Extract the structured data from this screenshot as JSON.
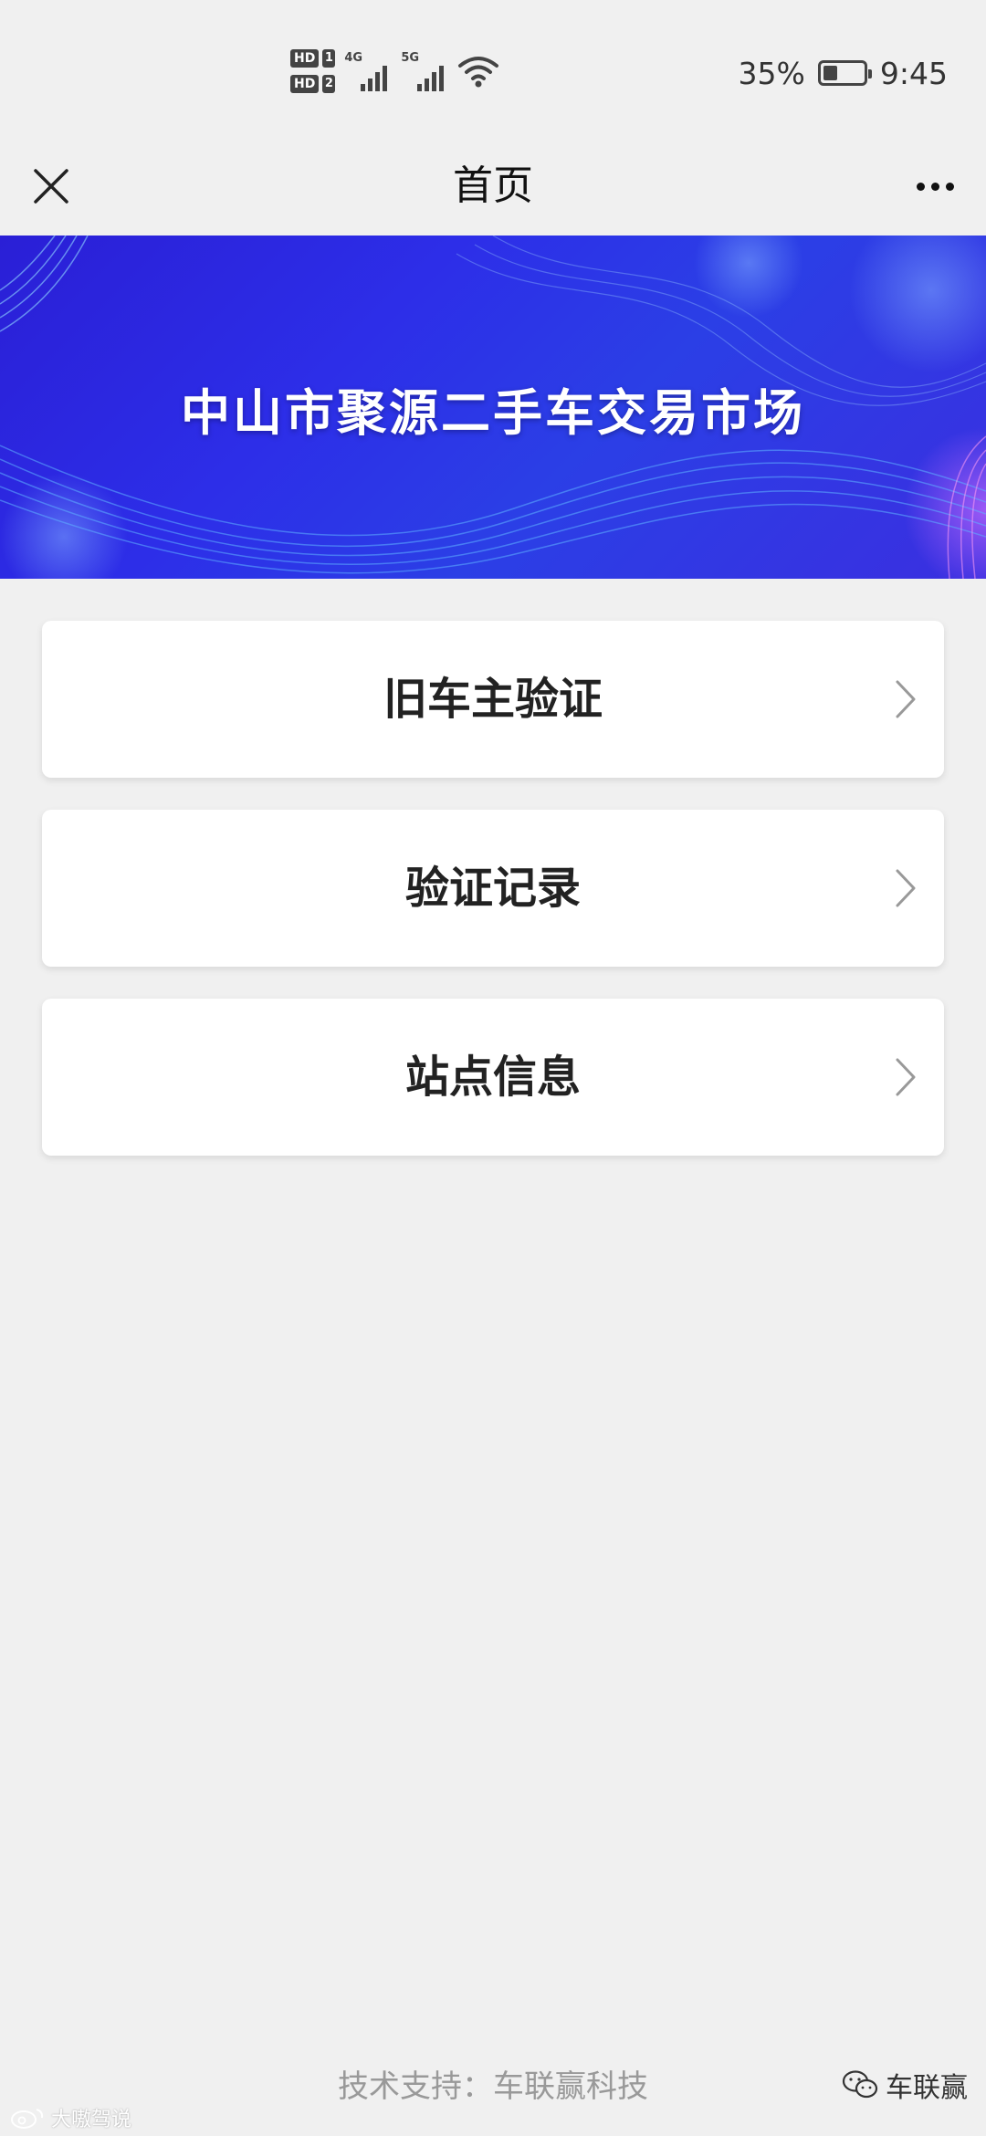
{
  "status_bar": {
    "sim1_label": "HD",
    "sim1_num": "1",
    "sim2_label": "HD",
    "sim2_num": "2",
    "network1": "4G",
    "network2": "5G",
    "battery_percent": "35%",
    "battery_level": 0.35,
    "time": "9:45"
  },
  "navbar": {
    "title": "首页",
    "close_icon": "close-icon",
    "more_icon": "more-icon"
  },
  "banner": {
    "title": "中山市聚源二手车交易市场"
  },
  "menu": {
    "items": [
      {
        "label": "旧车主验证"
      },
      {
        "label": "验证记录"
      },
      {
        "label": "站点信息"
      }
    ]
  },
  "footer": {
    "text": "技术支持：车联赢科技"
  },
  "watermarks": {
    "wechat_account": "车联赢",
    "left_source": "大嗷驾说"
  },
  "colors": {
    "page_bg": "#f0f0f0",
    "banner_blue": "#2d2ee8",
    "card_bg": "#ffffff",
    "footer_text": "#999999"
  }
}
